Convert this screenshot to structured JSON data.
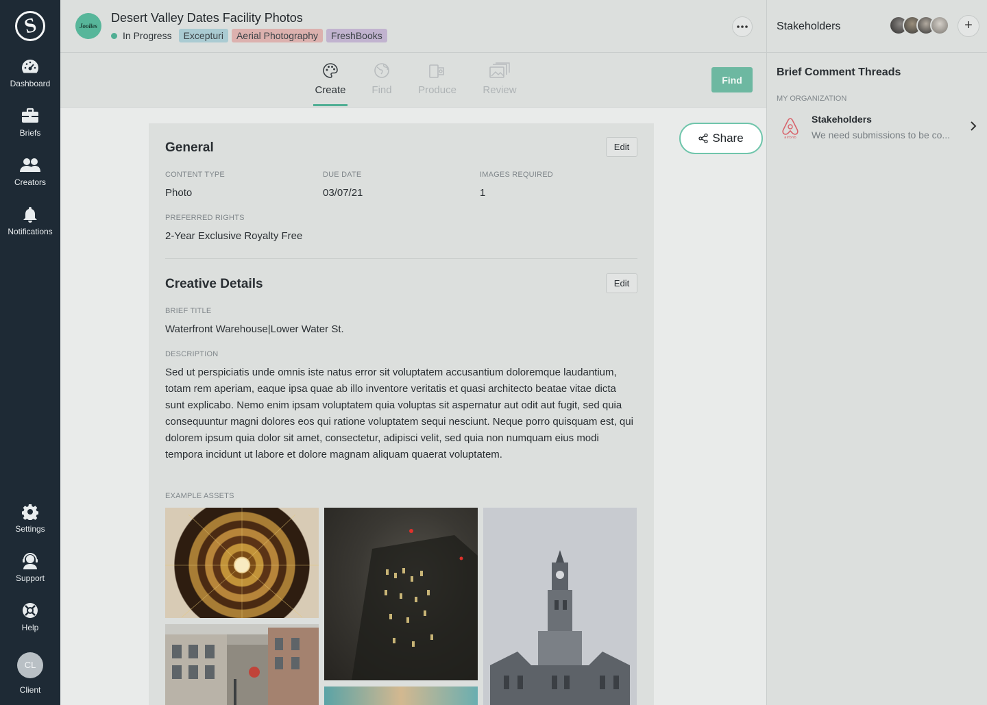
{
  "sidebar": {
    "logo": "S",
    "items": [
      {
        "label": "Dashboard",
        "icon": "dashboard-icon"
      },
      {
        "label": "Briefs",
        "icon": "briefcase-icon"
      },
      {
        "label": "Creators",
        "icon": "creators-icon"
      },
      {
        "label": "Notifications",
        "icon": "bell-icon"
      }
    ],
    "bottom_items": [
      {
        "label": "Settings",
        "icon": "gear-icon"
      },
      {
        "label": "Support",
        "icon": "support-icon"
      },
      {
        "label": "Help",
        "icon": "lifebuoy-icon"
      }
    ],
    "user": {
      "initials": "CL",
      "label": "Client"
    }
  },
  "header": {
    "brand_logo_text": "Joolies",
    "title": "Desert Valley Dates Facility Photos",
    "status": "In Progress",
    "tags": [
      "Excepturi",
      "Aerial Photography",
      "FreshBooks"
    ]
  },
  "tabs": [
    {
      "label": "Create",
      "icon": "palette-icon",
      "active": true
    },
    {
      "label": "Find",
      "icon": "globe-icon",
      "active": false
    },
    {
      "label": "Produce",
      "icon": "clapper-icon",
      "active": false
    },
    {
      "label": "Review",
      "icon": "images-icon",
      "active": false
    }
  ],
  "actions": {
    "find_label": "Find",
    "share_label": "Share"
  },
  "general": {
    "title": "General",
    "edit_label": "Edit",
    "content_type_label": "CONTENT TYPE",
    "content_type": "Photo",
    "due_date_label": "DUE DATE",
    "due_date": "03/07/21",
    "images_required_label": "IMAGES REQUIRED",
    "images_required": "1",
    "preferred_rights_label": "PREFERRED RIGHTS",
    "preferred_rights": "2-Year Exclusive Royalty Free"
  },
  "creative": {
    "title": "Creative Details",
    "edit_label": "Edit",
    "brief_title_label": "BRIEF TITLE",
    "brief_title": "Waterfront Warehouse|Lower Water St.",
    "description_label": "DESCRIPTION",
    "description": "Sed ut perspiciatis unde omnis iste natus error sit voluptatem accusantium doloremque laudantium, totam rem aperiam, eaque ipsa quae ab illo inventore veritatis et quasi architecto beatae vitae dicta sunt explicabo. Nemo enim ipsam voluptatem quia voluptas sit aspernatur aut odit aut fugit, sed quia consequuntur magni dolores eos qui ratione voluptatem sequi nesciunt. Neque porro quisquam est, qui dolorem ipsum quia dolor sit amet, consectetur, adipisci velit, sed quia non numquam eius modi tempora incidunt ut labore et dolore magnam aliquam quaerat voluptatem.",
    "example_assets_label": "EXAMPLE ASSETS"
  },
  "right_panel": {
    "stakeholders_title": "Stakeholders",
    "add_label": "+",
    "threads_title": "Brief Comment Threads",
    "org_label": "MY ORGANIZATION",
    "thread": {
      "name": "Stakeholders",
      "message": "We need submissions to be co...",
      "logo_text": "airbnb"
    }
  },
  "colors": {
    "sidebar_bg": "#1e2a35",
    "accent": "#4fae93",
    "share_border": "#6fc5ab"
  }
}
